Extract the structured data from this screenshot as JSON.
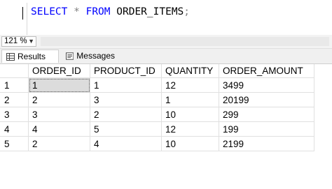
{
  "editor": {
    "keyword_select": "SELECT",
    "star": "*",
    "keyword_from": "FROM",
    "table_name": "ORDER_ITEMS",
    "terminator": ";"
  },
  "statusbar": {
    "zoom": "121 %"
  },
  "tabs": [
    {
      "label": "Results",
      "icon": "results-grid-icon"
    },
    {
      "label": "Messages",
      "icon": "messages-icon"
    }
  ],
  "results": {
    "columns": [
      "ORDER_ID",
      "PRODUCT_ID",
      "QUANTITY",
      "ORDER_AMOUNT"
    ],
    "rows": [
      {
        "n": "1",
        "cells": [
          "1",
          "1",
          "12",
          "3499"
        ]
      },
      {
        "n": "2",
        "cells": [
          "2",
          "3",
          "1",
          "20199"
        ]
      },
      {
        "n": "3",
        "cells": [
          "3",
          "2",
          "10",
          "299"
        ]
      },
      {
        "n": "4",
        "cells": [
          "4",
          "5",
          "12",
          "199"
        ]
      },
      {
        "n": "5",
        "cells": [
          "2",
          "4",
          "10",
          "2199"
        ]
      }
    ]
  },
  "colors": {
    "keyword": "#0000ff",
    "operator": "#808080",
    "selected_cell": "#dcdcdc"
  }
}
